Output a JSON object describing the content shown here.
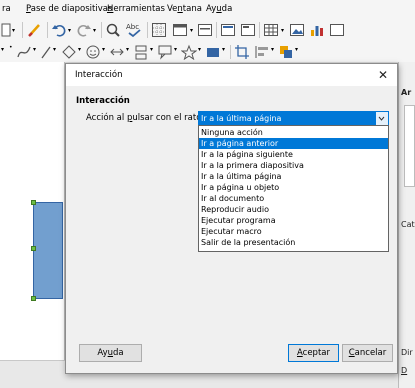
{
  "menubar": {
    "items": [
      {
        "pre": "",
        "acc": "",
        "post": "ra"
      },
      {
        "pre": "",
        "acc": "P",
        "post": "ase de diapositivas"
      },
      {
        "pre": "",
        "acc": "H",
        "post": "erramientas"
      },
      {
        "pre": "Ve",
        "acc": "n",
        "post": "tana"
      },
      {
        "pre": "Ay",
        "acc": "u",
        "post": "da"
      }
    ]
  },
  "sidebar": {
    "label_a": "Ar",
    "label_cat": "Cat",
    "label_dir": "Dir",
    "label_d": "D"
  },
  "dialog": {
    "title": "Interacción",
    "close_glyph": "✕",
    "section_heading": "Interacción",
    "action_label": {
      "pre": "Acción al ",
      "acc": "p",
      "post": "ulsar con el ratón:"
    },
    "combo_value": "Ir a la última página",
    "dropdown_items": [
      "Ninguna acción",
      "Ir a página anterior",
      "Ir a la página siguiente",
      "Ir a la primera diapositiva",
      "Ir a la última página",
      "Ir a página u objeto",
      "Ir al documento",
      "Reproducir audio",
      "Ejecutar programa",
      "Ejecutar macro",
      "Salir de la presentación"
    ],
    "selected_dropdown_item": "Ir a página anterior",
    "buttons": {
      "help": {
        "pre": "Ay",
        "acc": "u",
        "post": "da"
      },
      "ok": {
        "pre": "",
        "acc": "A",
        "post": "ceptar"
      },
      "cancel": {
        "pre": "",
        "acc": "C",
        "post": "ancelar"
      }
    }
  },
  "colors": {
    "accent": "#0078d7",
    "shape_fill": "#729fcf",
    "handle": "#6cbe45"
  },
  "icons": [
    "new-icon",
    "undo-icon",
    "redo-icon",
    "find-icon",
    "spellcheck-icon",
    "grid-icon",
    "display-icon",
    "slide-icon",
    "table-icon",
    "image-icon",
    "chart-icon",
    "curve-icon",
    "line-icon",
    "shapes-icon",
    "smiley-icon",
    "arrows-icon",
    "flowchart-icon",
    "callout-icon",
    "star-icon",
    "fill-color-icon",
    "align-icon"
  ]
}
